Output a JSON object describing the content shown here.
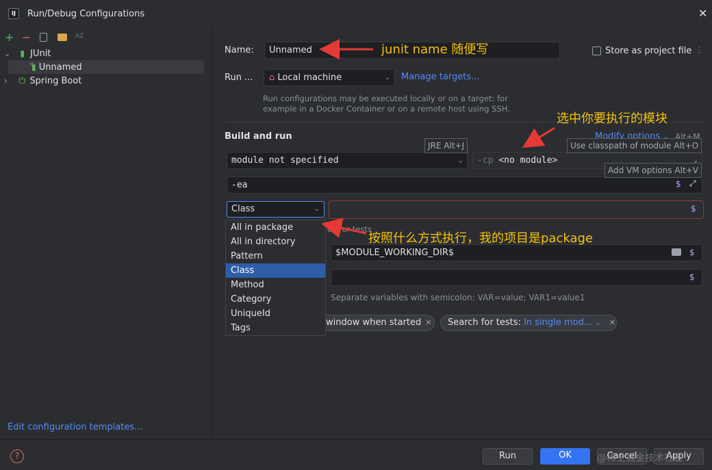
{
  "window": {
    "title": "Run/Debug Configurations",
    "logo_text": "IJ"
  },
  "toolbar": {
    "add": "+",
    "remove": "−",
    "sort": "AZ"
  },
  "tree": {
    "junit_label": "JUnit",
    "unnamed_label": "Unnamed",
    "springboot_label": "Spring Boot"
  },
  "left_footer": {
    "edit_templates": "Edit configuration templates..."
  },
  "form": {
    "name_label": "Name:",
    "name_value": "Unnamed",
    "store_label": "Store as project file",
    "run_label": "Run ...",
    "run_target": "Local machine",
    "manage_targets": "Manage targets...",
    "run_hint_line1": "Run configurations may be executed locally or on a target: for",
    "run_hint_line2": "example in a Docker Container or on a remote host using SSH.",
    "build_run_title": "Build and run",
    "modify_options": "Modify options",
    "modify_shortcut": "Alt+M",
    "jre_tooltip": "JRE Alt+J",
    "classpath_tooltip": "Use classpath of module Alt+O",
    "vm_tooltip": "Add VM options Alt+V",
    "module_value": "module not specified",
    "cp_prefix": "-cp",
    "cp_value": "<no module>",
    "vm_value": "-ea",
    "test_kind": "Class",
    "search_hint_fragment": "ch for tests",
    "workdir_value": "$MODULE_WORKING_DIR$",
    "env_hint": "Separate variables with semicolon: VAR=value; VAR1=value1",
    "tag_window": "window when started",
    "tag_search_label": "Search for tests:",
    "tag_search_value": "In single mod..."
  },
  "dropdown": {
    "items": [
      "All in package",
      "All in directory",
      "Pattern",
      "Class",
      "Method",
      "Category",
      "UniqueId",
      "Tags"
    ],
    "selected": "Class"
  },
  "buttons": {
    "run": "Run",
    "ok": "OK",
    "cancel": "Cancel",
    "apply": "Apply"
  },
  "annotations": {
    "name_note": "junit name 随便写",
    "module_note": "选中你要执行的模块",
    "kind_note": "按照什么方式执行，我的项目是package"
  },
  "watermark": "@稀土掘金技术社区",
  "colors": {
    "accent": "#548af7",
    "ok_button": "#3574f0",
    "annotation": "#f4c20d",
    "arrow": "#e53935",
    "error_border": "#8f3a3a"
  }
}
